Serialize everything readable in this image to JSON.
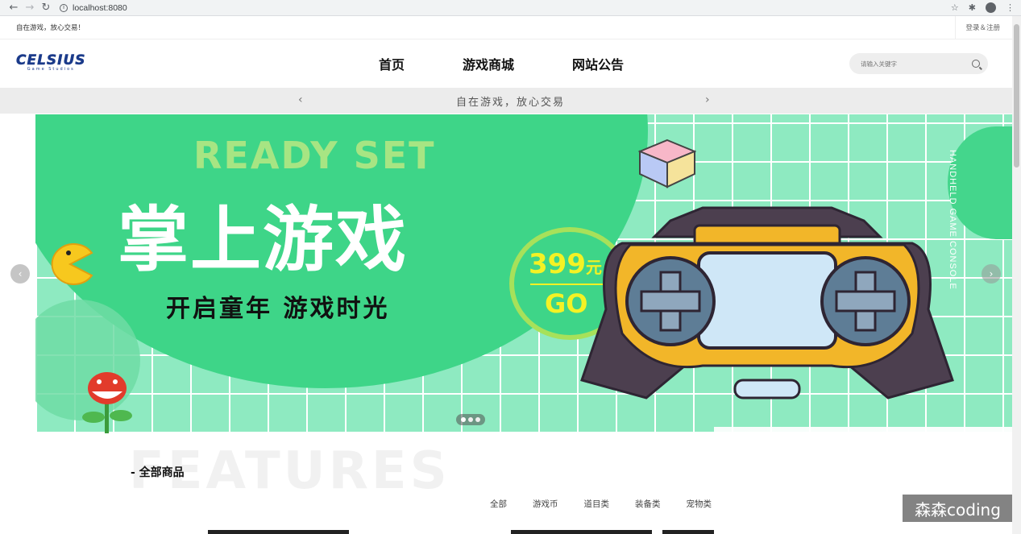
{
  "browser": {
    "url": "localhost:8080",
    "back_icon": "arrow-left-icon",
    "forward_icon": "arrow-right-icon",
    "reload_icon": "reload-icon"
  },
  "topstrip": {
    "slogan": "自在游戏，放心交易！",
    "login": "登录＆注册"
  },
  "header": {
    "logo_name": "CELSIUS",
    "logo_sub": "Game Studios",
    "nav": [
      "首页",
      "游戏商城",
      "网站公告"
    ],
    "search_placeholder": "请输入关键字"
  },
  "notice": {
    "text": "自在游戏，放心交易"
  },
  "banner": {
    "ready": "READY SET",
    "headline": "掌上游戏",
    "subline": "开启童年 游戏时光",
    "price": "399",
    "price_unit": "元",
    "go": "GO",
    "vertical": "HANDHELD GAME CONSOLE",
    "slide_count": 3,
    "active_slide": 1
  },
  "features": {
    "bg_text": "FEATURES",
    "title": "- 全部商品",
    "categories": [
      "全部",
      "游戏币",
      "道目类",
      "装备类",
      "宠物类"
    ]
  },
  "watermark": "森森coding",
  "colors": {
    "banner_bg": "#8eeac1",
    "banner_green": "#3ed588",
    "price_yellow": "#f4f224",
    "logo_blue": "#1a3a8a"
  }
}
